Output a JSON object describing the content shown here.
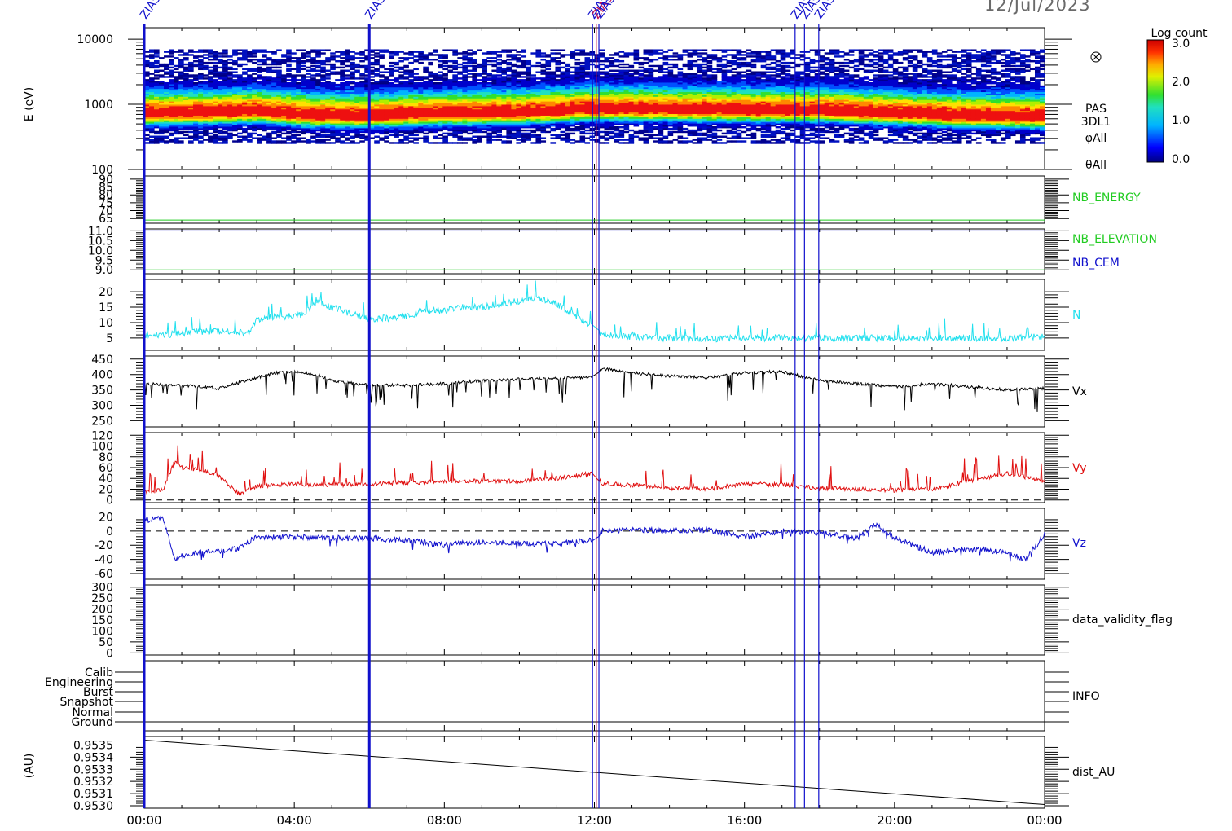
{
  "date": "12/Jul/2023",
  "time_axis": {
    "start_hour": 0,
    "end_hour": 24,
    "tick_labels": [
      "00:00",
      "04:00",
      "08:00",
      "12:00",
      "16:00",
      "20:00",
      "00:00"
    ]
  },
  "event_markers": [
    {
      "label": "ZIAS",
      "hour": 0.0,
      "color": "#1010cc"
    },
    {
      "label": "ZIAS",
      "hour": 6.0,
      "color": "#1010cc"
    },
    {
      "label": "ZIAS",
      "hour": 11.95,
      "color": "#1010cc"
    },
    {
      "label": "ZIAS",
      "hour": 12.05,
      "color": "#c01050"
    },
    {
      "label": "ZIAS",
      "hour": 12.12,
      "color": "#1010cc"
    },
    {
      "label": "ZIAS",
      "hour": 17.35,
      "color": "#1010cc"
    },
    {
      "label": "ZIAS",
      "hour": 17.6,
      "color": "#1010cc"
    },
    {
      "label": "ZIAS",
      "hour": 17.98,
      "color": "#1010cc"
    }
  ],
  "colorbar": {
    "title": "Log count",
    "ticks": [
      "3.0",
      "2.0",
      "1.0",
      "0.0"
    ]
  },
  "panel_side_labels": {
    "spectrogram": [
      "PAS",
      "3DL1",
      "φAll",
      "θAll"
    ],
    "nb_energy": "NB_ENERGY",
    "nb_elevation": "NB_ELEVATION",
    "nb_cem": "NB_CEM",
    "density": "N",
    "vx": "Vx",
    "vy": "Vy",
    "vz": "Vz",
    "validity": "data_validity_flag",
    "info": "INFO",
    "dist": "dist_AU"
  },
  "colors": {
    "nb_energy": "#22cc22",
    "nb_elevation": "#22cc22",
    "nb_cem": "#1010cc",
    "density": "#22e0ee",
    "vx": "#000000",
    "vy": "#e01010",
    "vz": "#1010cc",
    "marker_blue": "#1010cc"
  },
  "chart_data": [
    {
      "type": "heatmap",
      "panel": "spectrogram",
      "ylabel": "E (eV)",
      "yscale": "log",
      "ylim": [
        100,
        15000
      ],
      "yticks": [
        "10000",
        "1000",
        "100"
      ],
      "colorscale_range": [
        0.0,
        3.0
      ],
      "peak_energy_eV": [
        [
          0,
          700
        ],
        [
          2,
          720
        ],
        [
          3,
          760
        ],
        [
          4.5,
          650
        ],
        [
          6,
          640
        ],
        [
          8,
          700
        ],
        [
          10,
          720
        ],
        [
          12,
          820
        ],
        [
          14,
          800
        ],
        [
          16,
          780
        ],
        [
          18,
          780
        ],
        [
          20,
          700
        ],
        [
          22,
          640
        ],
        [
          24,
          620
        ]
      ]
    },
    {
      "type": "line",
      "panel": "nb_energy",
      "yticks": [
        "90",
        "85",
        "80",
        "75",
        "70",
        "65"
      ],
      "ylim": [
        62,
        92
      ],
      "series": [
        {
          "name": "NB_ENERGY",
          "x": [
            0,
            24
          ],
          "y": [
            64,
            64
          ]
        }
      ]
    },
    {
      "type": "line",
      "panel": "nb_elevation",
      "yticks": [
        "11.0",
        "10.5",
        "10.0",
        "9.5",
        "9.0"
      ],
      "ylim": [
        8.8,
        11.1
      ],
      "series": [
        {
          "name": "NB_ELEVATION",
          "x": [
            0,
            24
          ],
          "y": [
            9.0,
            9.0
          ]
        },
        {
          "name": "NB_CEM",
          "x": [
            0,
            24
          ],
          "y": [
            11.0,
            11.0
          ]
        }
      ]
    },
    {
      "type": "line",
      "panel": "density",
      "yticks": [
        "20",
        "15",
        "10",
        "5"
      ],
      "ylim": [
        1,
        24
      ],
      "series": [
        {
          "name": "N",
          "x": [
            0,
            0.5,
            1,
            1.5,
            2,
            2.5,
            2.8,
            3,
            3.5,
            4,
            4.3,
            4.6,
            5,
            5.5,
            6,
            6.5,
            7,
            7.5,
            8,
            8.5,
            9,
            9.5,
            10,
            10.5,
            11,
            11.5,
            11.9,
            12.1,
            12.5,
            13,
            13.5,
            14,
            15,
            16,
            17,
            18,
            19,
            20,
            21,
            22,
            23,
            24
          ],
          "y": [
            6,
            6,
            6.5,
            7,
            7,
            7,
            6.5,
            11,
            12,
            12,
            13,
            17,
            15,
            13,
            11,
            11.5,
            12,
            14,
            14,
            15,
            15,
            16,
            17,
            18,
            16,
            12,
            9,
            7,
            6,
            5.5,
            5,
            5,
            4.5,
            5,
            5,
            5,
            5,
            5,
            5,
            5,
            5,
            5.5
          ]
        }
      ]
    },
    {
      "type": "line",
      "panel": "vx",
      "yticks": [
        "450",
        "400",
        "350",
        "300",
        "250"
      ],
      "ylim": [
        230,
        460
      ],
      "series": [
        {
          "name": "Vx",
          "x": [
            0,
            1,
            2,
            3,
            3.5,
            4,
            4.3,
            4.6,
            5,
            6,
            7,
            8,
            9,
            10,
            11,
            12,
            12.2,
            13,
            14,
            15,
            16,
            17,
            18,
            19,
            20,
            21,
            22,
            23,
            24
          ],
          "y": [
            370,
            365,
            355,
            390,
            405,
            410,
            405,
            400,
            380,
            365,
            365,
            370,
            380,
            385,
            388,
            392,
            420,
            405,
            395,
            390,
            405,
            410,
            380,
            370,
            360,
            370,
            360,
            350,
            355
          ]
        }
      ]
    },
    {
      "type": "line",
      "panel": "vy",
      "yticks": [
        "120",
        "100",
        "80",
        "60",
        "40",
        "20",
        "0"
      ],
      "ylim": [
        -5,
        125
      ],
      "reference_line": 0,
      "series": [
        {
          "name": "Vy",
          "x": [
            0,
            0.5,
            0.8,
            1,
            1.5,
            2,
            2.5,
            3,
            4,
            5,
            6,
            7,
            8,
            9,
            10,
            11,
            12,
            12.2,
            13,
            14,
            15,
            16,
            17,
            18,
            19,
            20,
            21,
            22,
            23,
            24
          ],
          "y": [
            15,
            18,
            70,
            60,
            55,
            45,
            12,
            25,
            30,
            28,
            30,
            32,
            35,
            35,
            35,
            40,
            50,
            30,
            28,
            22,
            20,
            30,
            28,
            22,
            20,
            18,
            20,
            35,
            50,
            35
          ]
        }
      ]
    },
    {
      "type": "line",
      "panel": "vz",
      "yticks": [
        "20",
        "0",
        "-20",
        "-40",
        "-60"
      ],
      "ylim": [
        -68,
        32
      ],
      "reference_line": 0,
      "series": [
        {
          "name": "Vz",
          "x": [
            0,
            0.5,
            0.8,
            1,
            1.5,
            2,
            2.5,
            3,
            4,
            5,
            6,
            7,
            8,
            9,
            10,
            11,
            12,
            12.2,
            13,
            14,
            15,
            16,
            17,
            18,
            19,
            19.5,
            20,
            21,
            22,
            23,
            23.5,
            24
          ],
          "y": [
            15,
            20,
            -40,
            -35,
            -30,
            -28,
            -25,
            -8,
            -8,
            -10,
            -10,
            -13,
            -20,
            -15,
            -18,
            -18,
            -12,
            0,
            2,
            0,
            2,
            -8,
            0,
            -2,
            -10,
            10,
            -10,
            -30,
            -25,
            -30,
            -40,
            -5
          ]
        }
      ]
    },
    {
      "type": "line",
      "panel": "validity",
      "yticks": [
        "300",
        "250",
        "200",
        "150",
        "100",
        "50",
        "0"
      ],
      "ylim": [
        -10,
        310
      ],
      "series": []
    },
    {
      "type": "line",
      "panel": "info",
      "yticks": [
        "Calib",
        "Engineering",
        "Burst",
        "Snapshot",
        "Normal",
        "Ground"
      ],
      "series": []
    },
    {
      "type": "line",
      "panel": "dist",
      "ylabel": "(AU)",
      "yticks": [
        "0.9535",
        "0.9534",
        "0.9533",
        "0.9532",
        "0.9531",
        "0.9530"
      ],
      "ylim": [
        0.95298,
        0.95357
      ],
      "series": [
        {
          "name": "dist_AU",
          "x": [
            0,
            24
          ],
          "y": [
            0.95354,
            0.95301
          ]
        }
      ]
    }
  ]
}
